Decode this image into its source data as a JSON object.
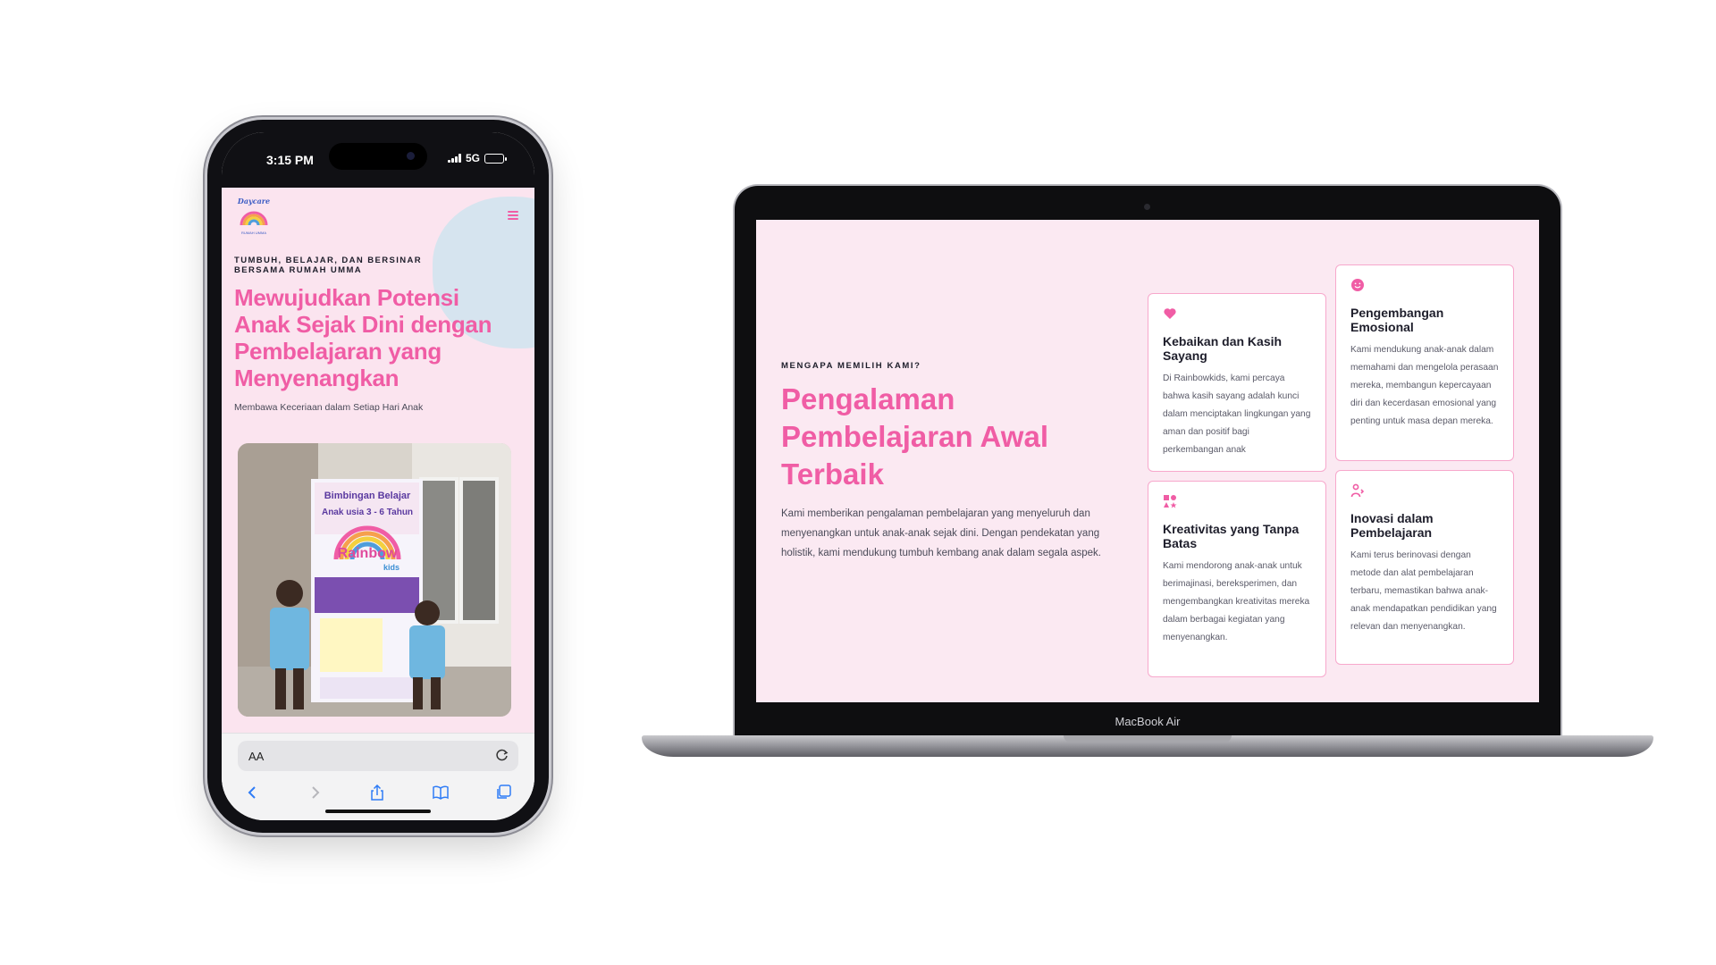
{
  "phone": {
    "status": {
      "time": "3:15 PM",
      "network": "5G",
      "battery_level": 0.9
    },
    "logo": {
      "name": "Daycare",
      "subtitle": "RUMAH UMMA"
    },
    "hero": {
      "kicker": "TUMBUH, BELAJAR, DAN BERSINAR BERSAMA RUMAH UMMA",
      "title": "Mewujudkan Potensi Anak Sejak Dini dengan Pembelajaran yang Menyenangkan",
      "subtitle": "Membawa Keceriaan dalam Setiap Hari Anak"
    },
    "photo": {
      "banner_title_line1": "Bimbingan Belajar",
      "banner_title_line2": "Anak usia 3 - 6 Tahun",
      "banner_brand": "Rainbow",
      "banner_brand_sub": "kids"
    },
    "browser": {
      "text_size_label": "AA"
    },
    "icons": [
      "menu-icon",
      "reload-icon",
      "back-icon",
      "forward-icon",
      "share-icon",
      "bookmarks-icon",
      "tabs-icon"
    ]
  },
  "laptop": {
    "brand": "MacBook Air",
    "section": {
      "kicker": "MENGAPA MEMILIH KAMI?",
      "title": "Pengalaman Pembelajaran Awal Terbaik",
      "body": "Kami memberikan pengalaman pembelajaran yang menyeluruh dan menyenangkan untuk anak-anak sejak dini. Dengan pendekatan yang holistik, kami mendukung tumbuh kembang anak dalam segala aspek."
    },
    "cards": [
      {
        "icon": "heart-icon",
        "title": "Kebaikan dan Kasih Sayang",
        "desc": "Di Rainbowkids, kami percaya bahwa kasih sayang adalah kunci dalam menciptakan lingkungan yang aman dan positif bagi perkembangan anak"
      },
      {
        "icon": "smile-icon",
        "title": "Pengembangan Emosional",
        "desc": "Kami mendukung anak-anak dalam memahami dan mengelola perasaan mereka, membangun kepercayaan diri dan kecerdasan emosional yang penting untuk masa depan mereka."
      },
      {
        "icon": "shapes-icon",
        "title": "Kreativitas yang Tanpa Batas",
        "desc": "Kami mendorong anak-anak untuk berimajinasi, bereksperimen, dan mengembangkan kreativitas mereka dalam berbagai kegiatan yang menyenangkan."
      },
      {
        "icon": "innovation-icon",
        "title": "Inovasi dalam Pembelajaran",
        "desc": "Kami terus berinovasi dengan metode dan alat pembelajaran terbaru, memastikan bahwa anak-anak mendapatkan pendidikan yang relevan dan menyenangkan."
      }
    ]
  },
  "colors": {
    "accent": "#f05da5",
    "page_bg": "#fbe9f2",
    "card_border": "#f7a8cc",
    "text_dark": "#1e1e2b"
  }
}
